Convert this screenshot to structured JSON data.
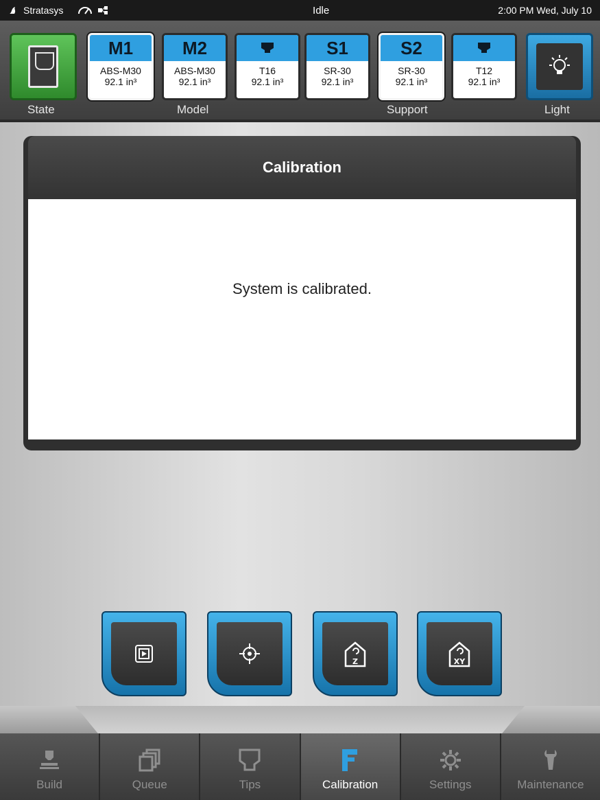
{
  "status_bar": {
    "brand": "Stratasys",
    "state": "Idle",
    "datetime": "2:00 PM Wed, July 10"
  },
  "header": {
    "state_label": "State",
    "model_label": "Model",
    "support_label": "Support",
    "light_label": "Light",
    "bays": [
      {
        "code": "M1",
        "material": "ABS-M30",
        "volume": "92.1 in³"
      },
      {
        "code": "M2",
        "material": "ABS-M30",
        "volume": "92.1 in³"
      },
      {
        "code": "",
        "material": "T16",
        "volume": "92.1 in³"
      },
      {
        "code": "S1",
        "material": "SR-30",
        "volume": "92.1 in³"
      },
      {
        "code": "S2",
        "material": "SR-30",
        "volume": "92.1 in³"
      },
      {
        "code": "",
        "material": "T12",
        "volume": "92.1 in³"
      }
    ]
  },
  "panel": {
    "title": "Calibration",
    "message": "System is calibrated."
  },
  "actions": [
    {
      "icon": "play-card-icon"
    },
    {
      "icon": "crosshair-icon"
    },
    {
      "icon": "home-z-icon",
      "label": "Z"
    },
    {
      "icon": "home-xy-icon",
      "label": "XY"
    }
  ],
  "nav": [
    {
      "label": "Build"
    },
    {
      "label": "Queue"
    },
    {
      "label": "Tips"
    },
    {
      "label": "Calibration"
    },
    {
      "label": "Settings"
    },
    {
      "label": "Maintenance"
    }
  ],
  "colors": {
    "accent": "#2f9fe0",
    "state_green": "#4cb548"
  }
}
